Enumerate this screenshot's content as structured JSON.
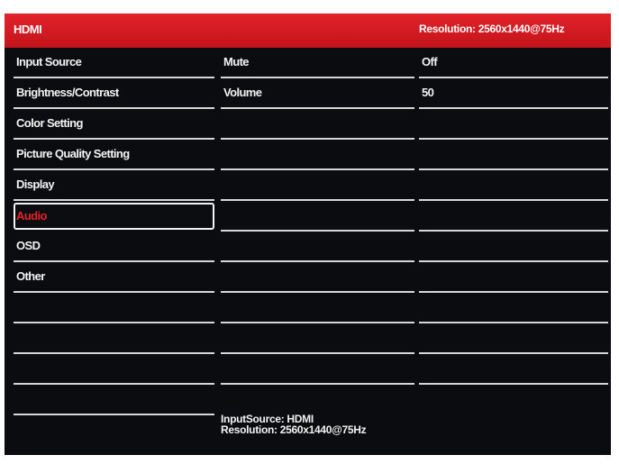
{
  "header": {
    "title": "HDMI",
    "resolution": "Resolution: 2560x1440@75Hz"
  },
  "menu": {
    "items": [
      {
        "label": "Input Source",
        "selected": false
      },
      {
        "label": "Brightness/Contrast",
        "selected": false
      },
      {
        "label": "Color Setting",
        "selected": false
      },
      {
        "label": "Picture Quality Setting",
        "selected": false
      },
      {
        "label": "Display",
        "selected": false
      },
      {
        "label": "Audio",
        "selected": true
      },
      {
        "label": "OSD",
        "selected": false
      },
      {
        "label": "Other",
        "selected": false
      }
    ]
  },
  "submenu": {
    "items": [
      {
        "label": "Mute",
        "value": "Off"
      },
      {
        "label": "Volume",
        "value": "50"
      }
    ]
  },
  "footer": {
    "input_source": "InputSource: HDMI",
    "resolution": "Resolution: 2560x1440@75Hz"
  },
  "colors": {
    "accent": "#e3242b",
    "background": "#0b0c0f",
    "text": "#f2f2f2"
  }
}
